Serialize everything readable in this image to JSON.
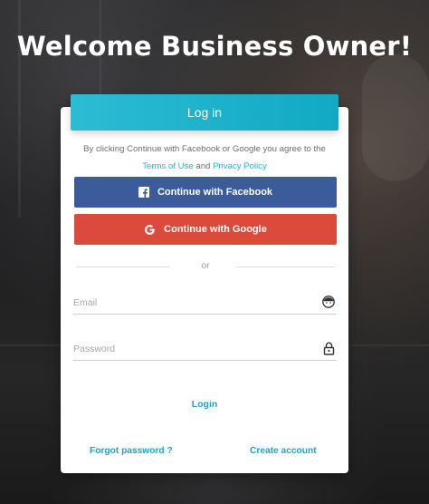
{
  "header": {
    "title": "Welcome Business Owner!"
  },
  "card": {
    "tab_label": "Log in",
    "terms": {
      "prefix": "By clicking Continue with Facebook or Google you agree to the ",
      "terms_link": "Terms of Use",
      "middle": " and ",
      "privacy_link": "Privacy Policy"
    },
    "facebook_button": {
      "label": "Continue with Facebook",
      "icon": "facebook-icon",
      "color": "#3b5b9a"
    },
    "google_button": {
      "label": "Continue with Google",
      "icon": "google-icon",
      "color": "#db4a3b"
    },
    "divider_text": "or",
    "email": {
      "placeholder": "Email",
      "value": "",
      "icon": "face-icon"
    },
    "password": {
      "placeholder": "Password",
      "value": "",
      "icon": "lock-icon"
    },
    "login_label": "Login",
    "forgot_label": "Forgot password ?",
    "create_label": "Create account"
  },
  "colors": {
    "accent": "#1aa6bf",
    "tab": "#11a9c3"
  }
}
